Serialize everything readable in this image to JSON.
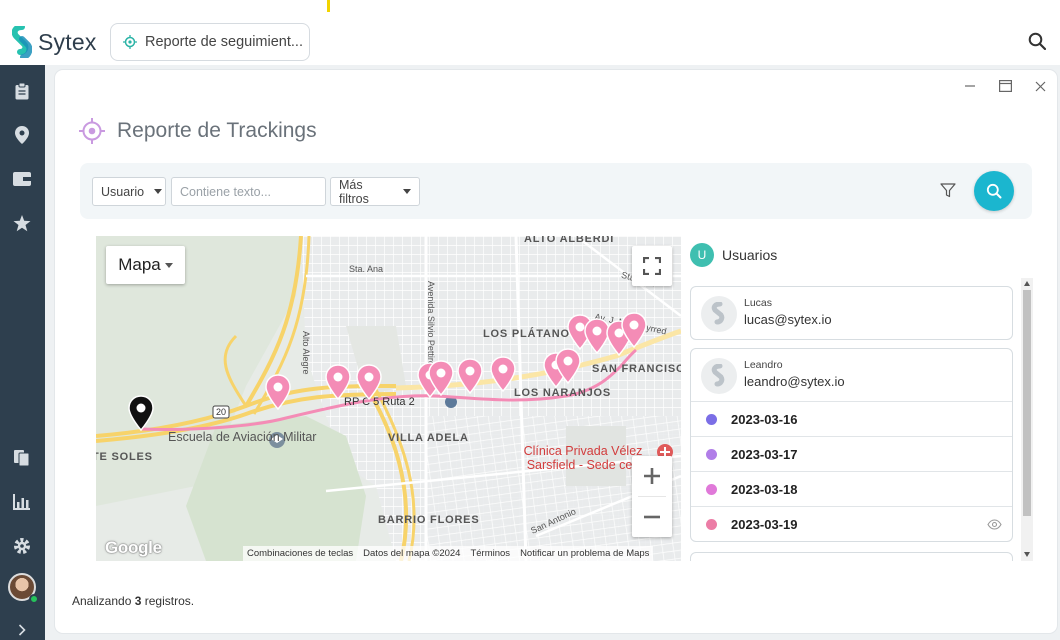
{
  "app": {
    "name": "Sytex"
  },
  "tab": {
    "label": "Reporte de seguimient..."
  },
  "page": {
    "title": "Reporte de Trackings"
  },
  "filters": {
    "user_label": "Usuario",
    "text_placeholder": "Contiene texto...",
    "more_label": "Más filtros"
  },
  "map": {
    "type_label": "Mapa",
    "labels": {
      "alto_alberdi": "ALTO ALBERDI",
      "sta_ana_1": "Sta. Ana",
      "sta_ana_2": "Sta. Ana",
      "alto_alegre": "Alto Alegre",
      "avenida_silvio": "Avenida Silvio Pettirossi",
      "av_ciudad": "Av. Ciudad de Valparaíso",
      "los_platanos": "LOS PLÁTANOS",
      "av_m_puey": "Av. J. M. Pueyrred",
      "san_francisco": "SAN FRANCISCO",
      "ruta": "RP C 5 Ruta 2",
      "los_naranjos": "LOS NARANJOS",
      "villa_adela": "VILLA ADELA",
      "te_soles": "TE SOLES",
      "route_20": "20",
      "escuela": "Escuela de Aviación Militar",
      "clinica": "Clínica Privada Vélez Sarsfield - Sede cen",
      "barrio_flores": "BARRIO FLORES",
      "san_antonio": "San Antonio"
    },
    "google": "Google",
    "attribution": {
      "shortcuts": "Combinaciones de teclas",
      "data": "Datos del mapa ©2024",
      "terms": "Términos",
      "report": "Notificar un problema de Maps"
    },
    "colors": {
      "route": "#f48cb6",
      "marker": "#f48cb6",
      "start_marker": "#111111"
    }
  },
  "users_panel": {
    "badge": "U",
    "title": "Usuarios",
    "users": [
      {
        "name": "Lucas",
        "email": "lucas@sytex.io"
      },
      {
        "name": "Leandro",
        "email": "leandro@sytex.io",
        "dates": [
          {
            "date": "2023-03-16",
            "color": "#7b6ee6"
          },
          {
            "date": "2023-03-17",
            "color": "#b17ee8"
          },
          {
            "date": "2023-03-18",
            "color": "#e079d9"
          },
          {
            "date": "2023-03-19",
            "color": "#ec7da6"
          }
        ]
      }
    ]
  },
  "footer": {
    "prefix": "Analizando",
    "count": "3",
    "suffix": "registros."
  },
  "icons": {
    "logo": "sytex-logo-icon",
    "tab": "target-icon",
    "search": "search-icon",
    "filter": "filter-icon",
    "fullscreen": "fullscreen-icon",
    "eye": "eye-icon"
  }
}
